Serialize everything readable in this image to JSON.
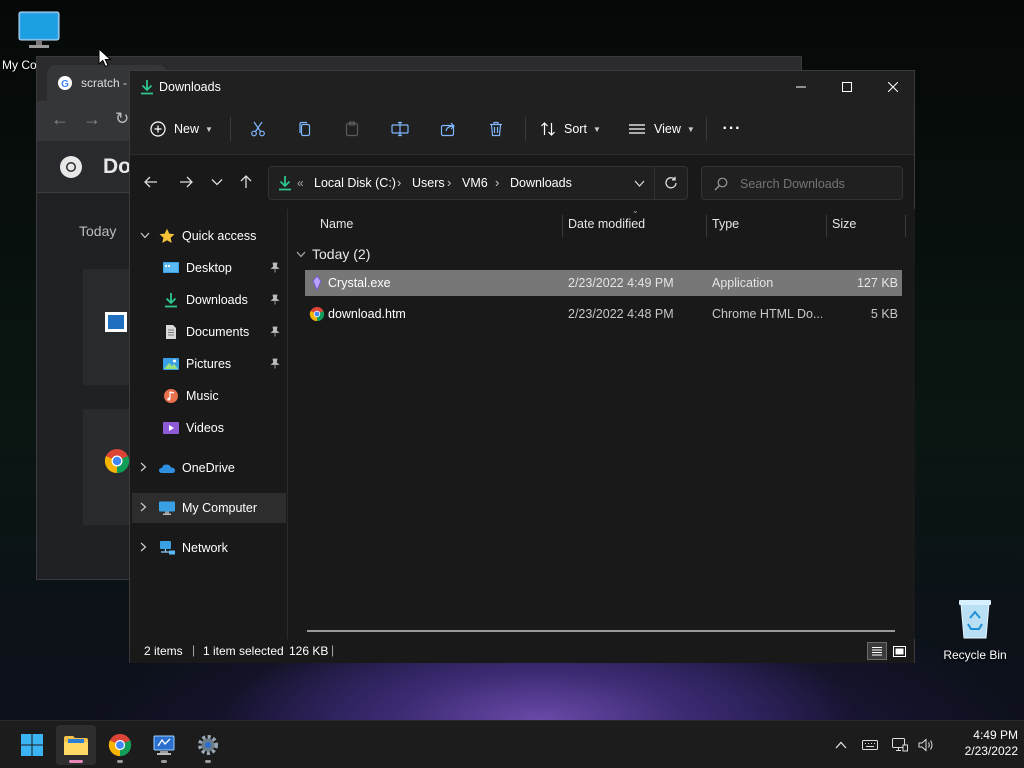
{
  "desktop": {
    "icons": [
      {
        "label": "My Co"
      },
      {
        "label": "Recycle Bin"
      }
    ]
  },
  "chrome_bg": {
    "tab_title": "scratch -",
    "header_title": "Do",
    "today_label": "Today"
  },
  "explorer": {
    "title": "Downloads",
    "controls": {
      "minimize": "—",
      "maximize": "☐",
      "close": "✕"
    },
    "toolbar": {
      "new_label": "New",
      "sort_label": "Sort",
      "view_label": "View",
      "more_label": "···"
    },
    "address": {
      "prefix": "«",
      "crumbs": [
        "Local Disk (C:)",
        "Users",
        "VM6",
        "Downloads"
      ],
      "sep": "›"
    },
    "search": {
      "placeholder": "Search Downloads"
    },
    "nav": {
      "quick_access": "Quick access",
      "items": [
        {
          "label": "Desktop",
          "pinned": true
        },
        {
          "label": "Downloads",
          "pinned": true
        },
        {
          "label": "Documents",
          "pinned": true
        },
        {
          "label": "Pictures",
          "pinned": true
        },
        {
          "label": "Music",
          "pinned": false
        },
        {
          "label": "Videos",
          "pinned": false
        }
      ],
      "onedrive": "OneDrive",
      "my_computer": "My Computer",
      "network": "Network"
    },
    "columns": {
      "name": "Name",
      "date": "Date modified",
      "type": "Type",
      "size": "Size"
    },
    "group": {
      "label": "Today (2)"
    },
    "files": [
      {
        "name": "Crystal.exe",
        "date": "2/23/2022 4:49 PM",
        "type": "Application",
        "size": "127 KB",
        "selected": true
      },
      {
        "name": "download.htm",
        "date": "2/23/2022 4:48 PM",
        "type": "Chrome HTML Do...",
        "size": "5 KB",
        "selected": false
      }
    ],
    "status": {
      "items": "2 items",
      "sep": "|",
      "selected": "1 item selected",
      "size": "126 KB"
    }
  },
  "taskbar": {
    "time": "4:49 PM",
    "date": "2/23/2022"
  },
  "colors": {
    "accent": "#0078d4",
    "selected_row": "#777777",
    "nav_selected": "#2d2d2d"
  }
}
